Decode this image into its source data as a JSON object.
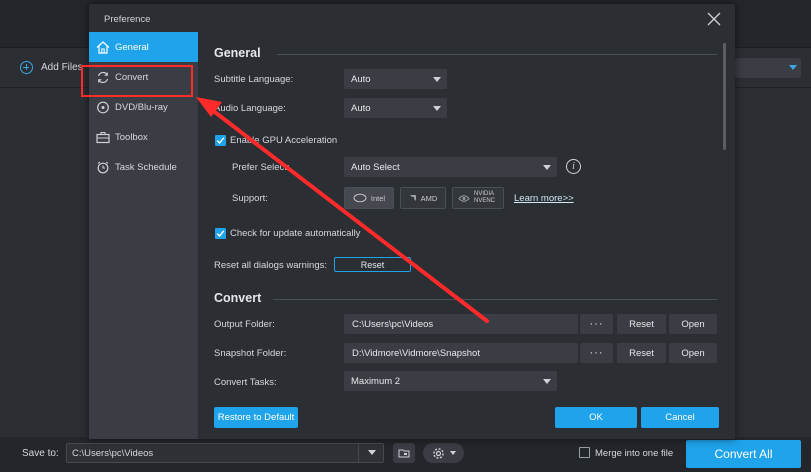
{
  "app": {
    "add_files_label": "Add Files",
    "save_to_label": "Save to:",
    "save_to_path": "C:\\Users\\pc\\Videos",
    "merge_label": "Merge into one file",
    "convert_all_label": "Convert All"
  },
  "dialog": {
    "title": "Preference",
    "sidebar": [
      {
        "label": "General",
        "icon": "home-icon",
        "active": true
      },
      {
        "label": "Convert",
        "icon": "refresh-icon",
        "active": false
      },
      {
        "label": "DVD/Blu-ray",
        "icon": "disc-icon",
        "active": false
      },
      {
        "label": "Toolbox",
        "icon": "toolbox-icon",
        "active": false
      },
      {
        "label": "Task Schedule",
        "icon": "clock-icon",
        "active": false
      }
    ],
    "general": {
      "title": "General",
      "subtitle_language_label": "Subtitle Language:",
      "subtitle_language_value": "Auto",
      "audio_language_label": "Audio Language:",
      "audio_language_value": "Auto",
      "gpu_label": "Enable GPU Acceleration",
      "gpu_checked": true,
      "prefer_select_label": "Prefer Select:",
      "prefer_select_value": "Auto Select",
      "support_label": "Support:",
      "support_items": [
        "Intel",
        "AMD",
        "NVIDIA NVENC"
      ],
      "learn_more": "Learn more>>",
      "update_label": "Check for update automatically",
      "update_checked": true,
      "reset_warnings_label": "Reset all dialogs warnings:",
      "reset_button": "Reset"
    },
    "convert": {
      "title": "Convert",
      "output_folder_label": "Output Folder:",
      "output_folder_value": "C:\\Users\\pc\\Videos",
      "snapshot_folder_label": "Snapshot Folder:",
      "snapshot_folder_value": "D:\\Vidmore\\Vidmore\\Snapshot",
      "dots_label": "···",
      "reset_label": "Reset",
      "open_label": "Open",
      "convert_tasks_label": "Convert Tasks:",
      "convert_tasks_value": "Maximum 2"
    },
    "footer": {
      "restore_label": "Restore to Default",
      "ok_label": "OK",
      "cancel_label": "Cancel"
    }
  },
  "colors": {
    "accent": "#1fa3ea",
    "annotation": "#ff2a2a"
  }
}
